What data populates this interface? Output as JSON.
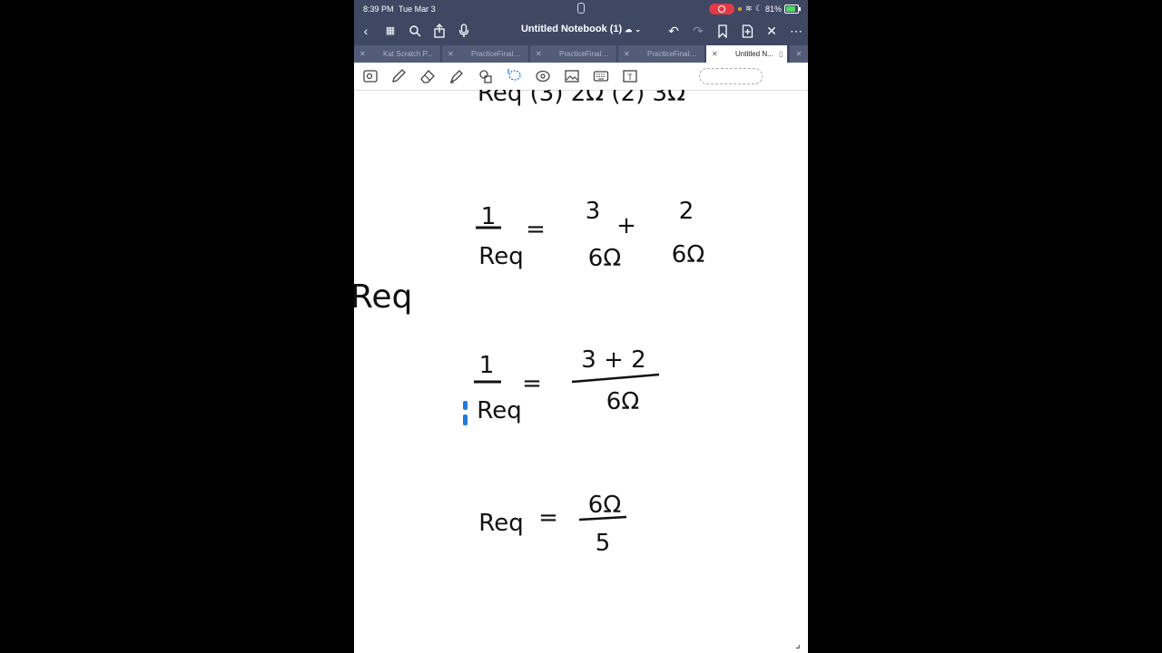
{
  "status": {
    "time": "8:39 PM",
    "date": "Tue Mar 3",
    "battery": "81%"
  },
  "nav": {
    "title": "Untitled Notebook (1)"
  },
  "tabs": [
    {
      "label": "Kat Scratch P...",
      "active": false
    },
    {
      "label": "PracticeFinalE...",
      "active": false
    },
    {
      "label": "PracticeFinalE...",
      "active": false
    },
    {
      "label": "PracticeFinalE...",
      "active": false
    },
    {
      "label": "Untitled N...",
      "active": true
    }
  ],
  "toolbar": {
    "tools": [
      "lasso-camera",
      "pen",
      "eraser",
      "highlighter",
      "shapes",
      "lasso",
      "sticker",
      "image",
      "keyboard",
      "text"
    ]
  },
  "notes": {
    "partial_top": "Req (3) 2Ω (2) 3Ω",
    "eq1": {
      "lhs_num": "1",
      "lhs_den": "Req",
      "t1_num": "3",
      "t1_den": "6Ω",
      "op": "+",
      "t2_num": "2",
      "t2_den": "6Ω"
    },
    "side": "Req",
    "eq2": {
      "lhs_num": "1",
      "lhs_den": "Req",
      "rhs_num": "3 + 2",
      "rhs_den": "6Ω"
    },
    "eq3": {
      "lhs": "Req",
      "rhs_num": "6Ω",
      "rhs_den": "5"
    },
    "equals": "="
  },
  "colors": {
    "nav_bg": "#3e4863",
    "recording": "#e13b46",
    "ink": "#111111",
    "cursor": "#1f7be0"
  }
}
